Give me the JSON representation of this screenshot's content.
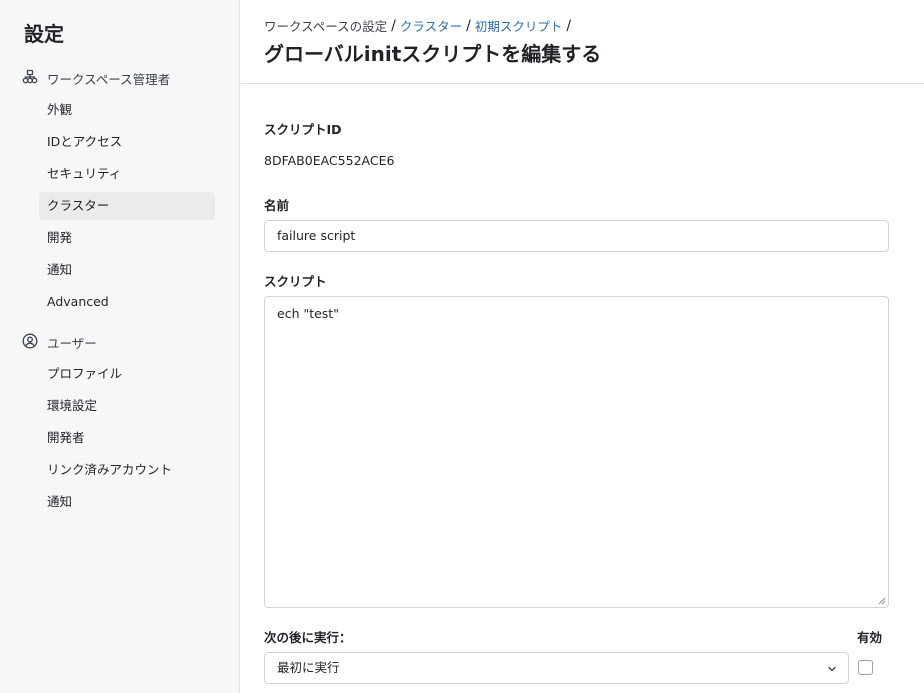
{
  "sidebar": {
    "title": "設定",
    "sections": [
      {
        "label": "ワークスペース管理者",
        "icon": "workspace-admin-icon",
        "items": [
          "外観",
          "IDとアクセス",
          "セキュリティ",
          "クラスター",
          "開発",
          "通知",
          "Advanced"
        ]
      },
      {
        "label": "ユーザー",
        "icon": "user-circle-icon",
        "items": [
          "プロファイル",
          "環境設定",
          "開発者",
          "リンク済みアカウント",
          "通知"
        ]
      }
    ],
    "active_item": "クラスター"
  },
  "breadcrumb": {
    "root": "ワークスペースの設定",
    "clusters": "クラスター",
    "init_scripts": "初期スクリプト",
    "separator": "/"
  },
  "page": {
    "title": "グローバルinitスクリプトを編集する"
  },
  "form": {
    "script_id_label": "スクリプトID",
    "script_id_value": "8DFAB0EAC552ACE6",
    "name_label": "名前",
    "name_value": "failure script",
    "script_label": "スクリプト",
    "script_value": "ech \"test\"",
    "run_after_label": "次の後に実行：",
    "run_after_value": "最初に実行",
    "enabled_label": "有効",
    "enabled_checked": false
  }
}
